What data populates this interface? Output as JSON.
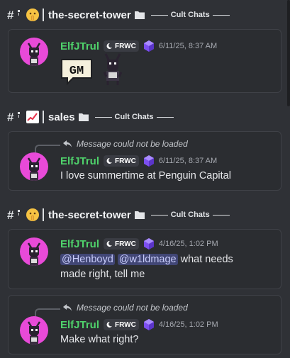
{
  "sections": [
    {
      "channel": {
        "emoji": "shushing-face-emoji",
        "name": "the-secret-tower",
        "category": "Cult Chats"
      },
      "message": {
        "username": "ElfJTrul",
        "tag": "FRWC",
        "timestamp": "6/11/25, 8:37 AM",
        "reply": null,
        "content": {
          "type": "stickers",
          "stickers": [
            {
              "name": "gm-speech-bubble-sticker",
              "text": "GM"
            },
            {
              "name": "pixel-creature-sticker"
            }
          ]
        }
      }
    },
    {
      "channel": {
        "emoji": "chart-increasing-emoji",
        "name": "sales",
        "category": "Cult Chats"
      },
      "message": {
        "username": "ElfJTrul",
        "tag": "FRWC",
        "timestamp": "6/11/25, 8:37 AM",
        "reply": "Message could not be loaded",
        "content": {
          "type": "text",
          "text": "I love summertime at Penguin Capital"
        }
      }
    },
    {
      "channel": {
        "emoji": "shushing-face-emoji",
        "name": "the-secret-tower",
        "category": "Cult Chats"
      },
      "message": {
        "username": "ElfJTrul",
        "tag": "FRWC",
        "timestamp": "4/16/25, 1:02 PM",
        "reply": null,
        "content": {
          "type": "mentions",
          "mentions": [
            "@Henboyd",
            "@w1ldmage"
          ],
          "text_after": "what needs",
          "line2": "made right, tell me"
        }
      }
    },
    {
      "channel": null,
      "message": {
        "username": "ElfJTrul",
        "tag": "FRWC",
        "timestamp": "4/16/25, 1:02 PM",
        "reply": "Message could not be loaded",
        "content": {
          "type": "text",
          "text": "Make what right?"
        }
      }
    }
  ],
  "colors": {
    "username": "#4fd26b",
    "avatar_bg": "#e84ad8",
    "mention_bg": "#414675",
    "gem": "#8b5cf6"
  }
}
